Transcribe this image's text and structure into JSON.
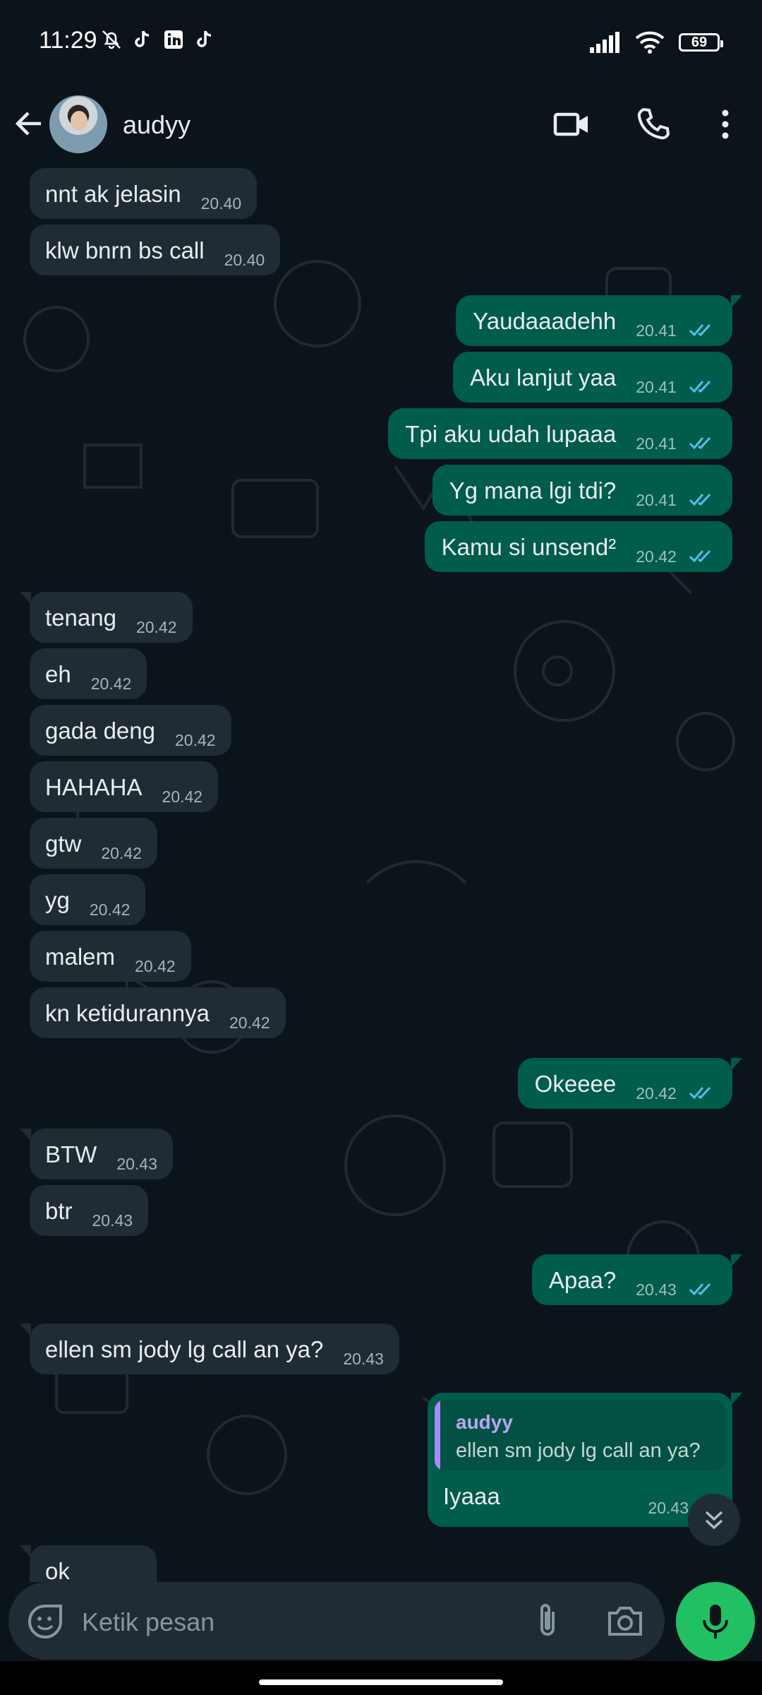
{
  "status_bar": {
    "time": "11:29",
    "battery": "69"
  },
  "header": {
    "contact_name": "audyy"
  },
  "messages": [
    {
      "dir": "in",
      "text": "nnt ak jelasin",
      "time": "20.40"
    },
    {
      "dir": "in",
      "text": "klw bnrn bs call",
      "time": "20.40"
    },
    {
      "dir": "out",
      "text": "Yaudaaadehh",
      "time": "20.41"
    },
    {
      "dir": "out",
      "text": "Aku lanjut yaa",
      "time": "20.41"
    },
    {
      "dir": "out",
      "text": "Tpi aku udah lupaaa",
      "time": "20.41"
    },
    {
      "dir": "out",
      "text": "Yg mana lgi tdi?",
      "time": "20.41"
    },
    {
      "dir": "out",
      "text": "Kamu si unsend²",
      "time": "20.42"
    },
    {
      "dir": "in",
      "text": "tenang",
      "time": "20.42"
    },
    {
      "dir": "in",
      "text": "eh",
      "time": "20.42"
    },
    {
      "dir": "in",
      "text": "gada deng",
      "time": "20.42"
    },
    {
      "dir": "in",
      "text": "HAHAHA",
      "time": "20.42"
    },
    {
      "dir": "in",
      "text": "gtw",
      "time": "20.42"
    },
    {
      "dir": "in",
      "text": "yg",
      "time": "20.42"
    },
    {
      "dir": "in",
      "text": "malem",
      "time": "20.42"
    },
    {
      "dir": "in",
      "text": "kn ketidurannya",
      "time": "20.42"
    },
    {
      "dir": "out",
      "text": "Okeeee",
      "time": "20.42"
    },
    {
      "dir": "in",
      "text": "BTW",
      "time": "20.43"
    },
    {
      "dir": "in",
      "text": "btr",
      "time": "20.43"
    },
    {
      "dir": "out",
      "text": "Apaa?",
      "time": "20.43"
    },
    {
      "dir": "in",
      "text": "ellen sm jody lg call an ya?",
      "time": "20.43"
    }
  ],
  "reply_message": {
    "quoted_name": "audyy",
    "quoted_text": "ellen sm jody lg call an ya?",
    "text": "Iyaaa",
    "time": "20.43"
  },
  "partial_message": {
    "text": "ok"
  },
  "input": {
    "placeholder": "Ketik pesan"
  },
  "colors": {
    "incoming": "#202c33",
    "outgoing": "#005c4b",
    "read_ticks": "#53bdeb",
    "mic": "#21c063"
  }
}
